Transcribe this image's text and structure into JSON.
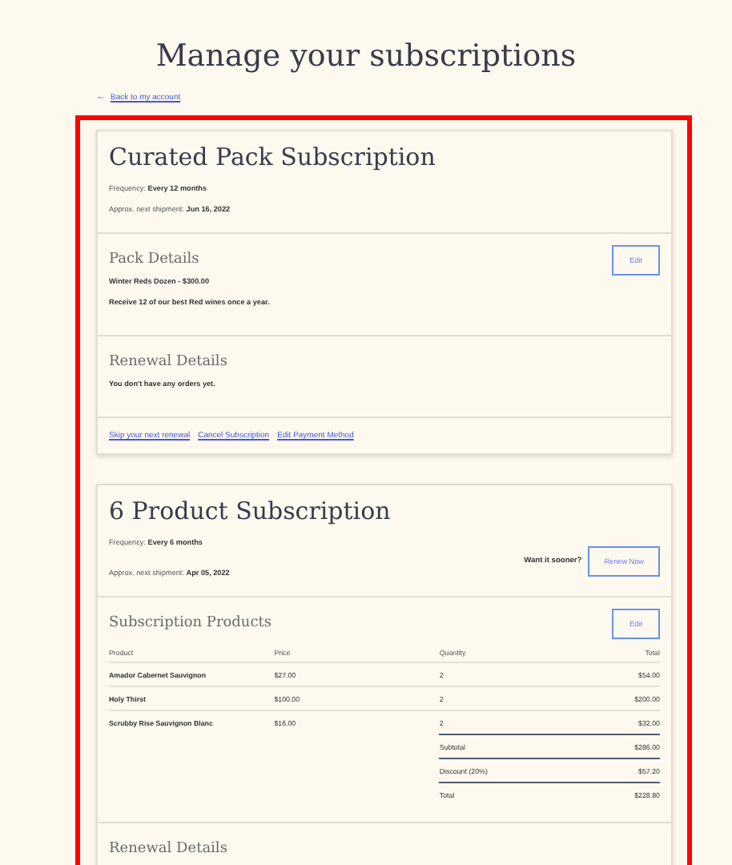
{
  "page_title": "Manage your subscriptions",
  "back_link": {
    "arrow": "←",
    "label": "Back to my account"
  },
  "subscriptions": [
    {
      "title": "Curated Pack Subscription",
      "frequency_label": "Frequency:",
      "frequency": "Every 12 months",
      "shipment_label": "Approx. next shipment:",
      "shipment": "Jun 16, 2022",
      "sections": [
        {
          "kind": "details",
          "heading": "Pack Details",
          "button": "Edit",
          "lines": [
            "Winter Reds Dozen - $300.00",
            "Receive 12 of our best Red wines once a year."
          ]
        },
        {
          "kind": "renewal",
          "heading": "Renewal Details",
          "lines": [
            "You don't have any orders yet."
          ]
        }
      ],
      "links": [
        "Skip your next renewal",
        "Cancel Subscription",
        "Edit Payment Method"
      ]
    },
    {
      "title": "6 Product Subscription",
      "frequency_label": "Frequency:",
      "frequency": "Every 6 months",
      "shipment_label": "Approx. next shipment:",
      "shipment": "Apr 05, 2022",
      "prompt": "Want it sooner?",
      "action": "Renew Now",
      "sections": [
        {
          "kind": "products",
          "heading": "Subscription Products",
          "button": "Edit",
          "columns": [
            "Product",
            "Price",
            "Quantity",
            "Total"
          ],
          "rows": [
            [
              "Amador Cabernet Sauvignon",
              "$27.00",
              "2",
              "$54.00"
            ],
            [
              "Holy Thirst",
              "$100.00",
              "2",
              "$200.00"
            ],
            [
              "Scrubby Rise Sauvignon Blanc",
              "$16.00",
              "2",
              "$32.00"
            ]
          ],
          "summary": [
            {
              "label": "Subtotal",
              "value": "$286.00"
            },
            {
              "label": "Discount (20%)",
              "value": "$57.20"
            },
            {
              "label": "Total",
              "value": "$228.80"
            }
          ]
        },
        {
          "kind": "renewal",
          "heading": "Renewal Details"
        }
      ]
    }
  ]
}
